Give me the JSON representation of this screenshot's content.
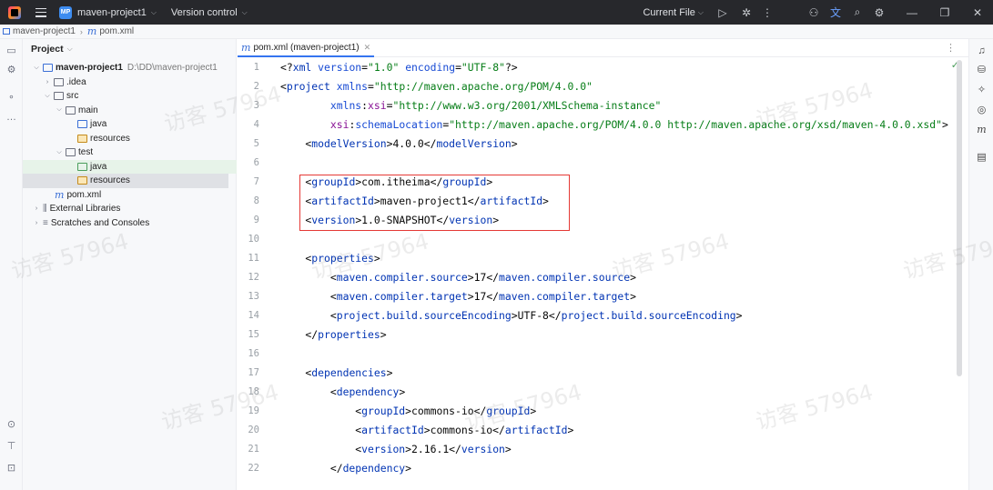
{
  "titlebar": {
    "project_badge": "MP",
    "project_name": "maven-project1",
    "version_control": "Version control",
    "current_file": "Current File"
  },
  "breadcrumb": {
    "project": "maven-project1",
    "file": "pom.xml"
  },
  "project_panel": {
    "title": "Project",
    "tree": [
      {
        "label": "maven-project1",
        "path": "D:\\DD\\maven-project1",
        "bold": true
      },
      {
        "label": ".idea"
      },
      {
        "label": "src"
      },
      {
        "label": "main"
      },
      {
        "label": "java"
      },
      {
        "label": "resources"
      },
      {
        "label": "test"
      },
      {
        "label": "java"
      },
      {
        "label": "resources"
      },
      {
        "label": "pom.xml"
      },
      {
        "label": "External Libraries"
      },
      {
        "label": "Scratches and Consoles"
      }
    ]
  },
  "editor": {
    "tab_label": "pom.xml (maven-project1)",
    "line_numbers": [
      "1",
      "2",
      "3",
      "4",
      "5",
      "6",
      "7",
      "8",
      "9",
      "10",
      "11",
      "12",
      "13",
      "14",
      "15",
      "16",
      "17",
      "18",
      "19",
      "20",
      "21",
      "22"
    ]
  },
  "watermark": "访客 57964",
  "colors": {
    "titlebar_bg": "#27282c",
    "tab_underline": "#3574f0",
    "highlight_box": "#e53935",
    "xml_tag": "#0033b3",
    "xml_value": "#067d17"
  }
}
